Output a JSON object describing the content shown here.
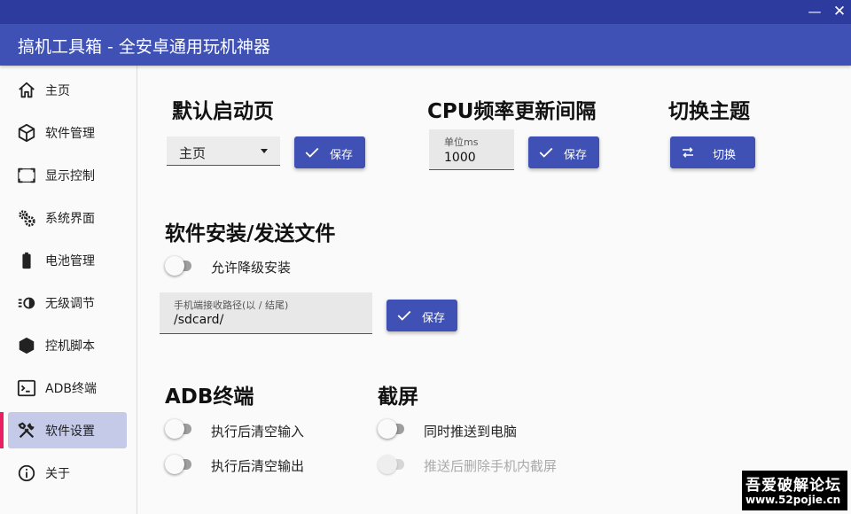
{
  "window": {
    "minimize_glyph": "—",
    "close_glyph": "✕",
    "title": "搞机工具箱 - 全安卓通用玩机神器",
    "accent_color": "#3f51b5",
    "titlebar_color": "#2e3b9e",
    "active_indicator_color": "#e91e63"
  },
  "sidebar": {
    "items": [
      {
        "label": "主页",
        "icon": "home-icon"
      },
      {
        "label": "软件管理",
        "icon": "package-icon"
      },
      {
        "label": "显示控制",
        "icon": "display-frame-icon"
      },
      {
        "label": "系统界面",
        "icon": "gears-icon"
      },
      {
        "label": "电池管理",
        "icon": "battery-icon"
      },
      {
        "label": "无级调节",
        "icon": "dimmer-icon"
      },
      {
        "label": "控机脚本",
        "icon": "hexagon-icon"
      },
      {
        "label": "ADB终端",
        "icon": "terminal-icon"
      },
      {
        "label": "软件设置",
        "icon": "tools-icon",
        "active": true
      },
      {
        "label": "关于",
        "icon": "info-icon"
      }
    ]
  },
  "default_page": {
    "heading": "默认启动页",
    "selected": "主页",
    "save_label": "保存"
  },
  "cpu_interval": {
    "heading": "CPU频率更新间隔",
    "unit_label": "单位ms",
    "value": "1000",
    "save_label": "保存"
  },
  "theme": {
    "heading": "切换主题",
    "switch_label": "切换"
  },
  "install": {
    "heading": "软件安装/发送文件",
    "downgrade_label": "允许降级安装",
    "downgrade_on": false,
    "path_label": "手机端接收路径(以 / 结尾)",
    "path_value": "/sdcard/",
    "save_label": "保存"
  },
  "adb": {
    "heading": "ADB终端",
    "clear_input_label": "执行后清空输入",
    "clear_input_on": false,
    "clear_output_label": "执行后清空输出",
    "clear_output_on": false
  },
  "screenshot": {
    "heading": "截屏",
    "push_label": "同时推送到电脑",
    "push_on": false,
    "delete_label": "推送后删除手机内截屏",
    "delete_on": false,
    "delete_enabled": false
  },
  "watermark": {
    "line1": "吾爱破解论坛",
    "line2": "www.52pojie.cn"
  }
}
